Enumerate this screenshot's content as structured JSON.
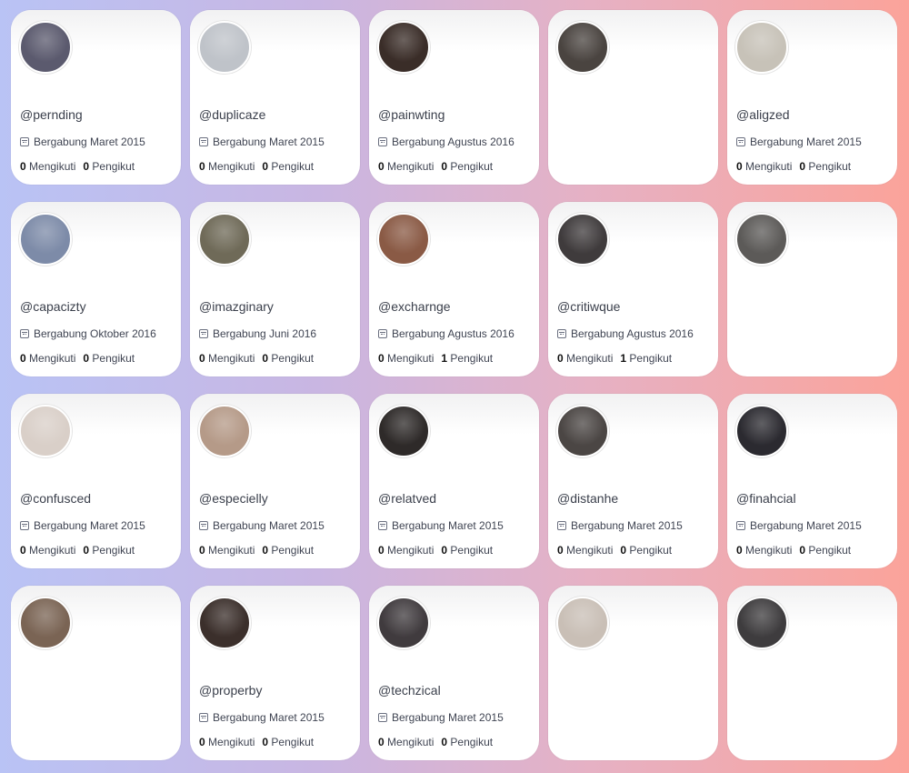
{
  "stats_labels": {
    "following": "Mengikuti",
    "followers": "Pengikut"
  },
  "cards": [
    {
      "handle": "@pernding",
      "joined": "Bergabung Maret 2015",
      "following": "0",
      "followers": "0",
      "avatar_color": "#5b5a6e"
    },
    {
      "handle": "@duplicaze",
      "joined": "Bergabung Maret 2015",
      "following": "0",
      "followers": "0",
      "avatar_color": "#bfc3c9"
    },
    {
      "handle": "@painwting",
      "joined": "Bergabung Agustus 2016",
      "following": "0",
      "followers": "0",
      "avatar_color": "#3a2d28"
    },
    {
      "handle": "",
      "joined": "",
      "following": "",
      "followers": "",
      "avatar_color": "#4a4440"
    },
    {
      "handle": "@aligzed",
      "joined": "Bergabung Maret 2015",
      "following": "0",
      "followers": "0",
      "avatar_color": "#c7c2b8"
    },
    {
      "handle": "@capacizty",
      "joined": "Bergabung Oktober 2016",
      "following": "0",
      "followers": "0",
      "avatar_color": "#7d8ba8"
    },
    {
      "handle": "@imazginary",
      "joined": "Bergabung Juni 2016",
      "following": "0",
      "followers": "0",
      "avatar_color": "#6f6a58"
    },
    {
      "handle": "@excharnge",
      "joined": "Bergabung Agustus 2016",
      "following": "0",
      "followers": "1",
      "avatar_color": "#8a5a45"
    },
    {
      "handle": "@critiwque",
      "joined": "Bergabung Agustus 2016",
      "following": "0",
      "followers": "1",
      "avatar_color": "#3f3b3c"
    },
    {
      "handle": "",
      "joined": "",
      "following": "",
      "followers": "",
      "avatar_color": "#5c5a58"
    },
    {
      "handle": "@confusced",
      "joined": "Bergabung Maret 2015",
      "following": "0",
      "followers": "0",
      "avatar_color": "#d9cfc8"
    },
    {
      "handle": "@especielly",
      "joined": "Bergabung Maret 2015",
      "following": "0",
      "followers": "0",
      "avatar_color": "#b59a88"
    },
    {
      "handle": "@relatved",
      "joined": "Bergabung Maret 2015",
      "following": "0",
      "followers": "0",
      "avatar_color": "#2e2a29"
    },
    {
      "handle": "@distanhe",
      "joined": "Bergabung Maret 2015",
      "following": "0",
      "followers": "0",
      "avatar_color": "#4b4644"
    },
    {
      "handle": "@finahcial",
      "joined": "Bergabung Maret 2015",
      "following": "0",
      "followers": "0",
      "avatar_color": "#2b2a30"
    },
    {
      "handle": "",
      "joined": "",
      "following": "",
      "followers": "",
      "avatar_color": "#7a6454"
    },
    {
      "handle": "@properby",
      "joined": "Bergabung Maret 2015",
      "following": "0",
      "followers": "0",
      "avatar_color": "#3b2f2b"
    },
    {
      "handle": "@techzical",
      "joined": "Bergabung Maret 2015",
      "following": "0",
      "followers": "0",
      "avatar_color": "#403b3e"
    },
    {
      "handle": "",
      "joined": "",
      "following": "",
      "followers": "",
      "avatar_color": "#c9bfb6"
    },
    {
      "handle": "",
      "joined": "",
      "following": "",
      "followers": "",
      "avatar_color": "#3e3c3e"
    }
  ]
}
